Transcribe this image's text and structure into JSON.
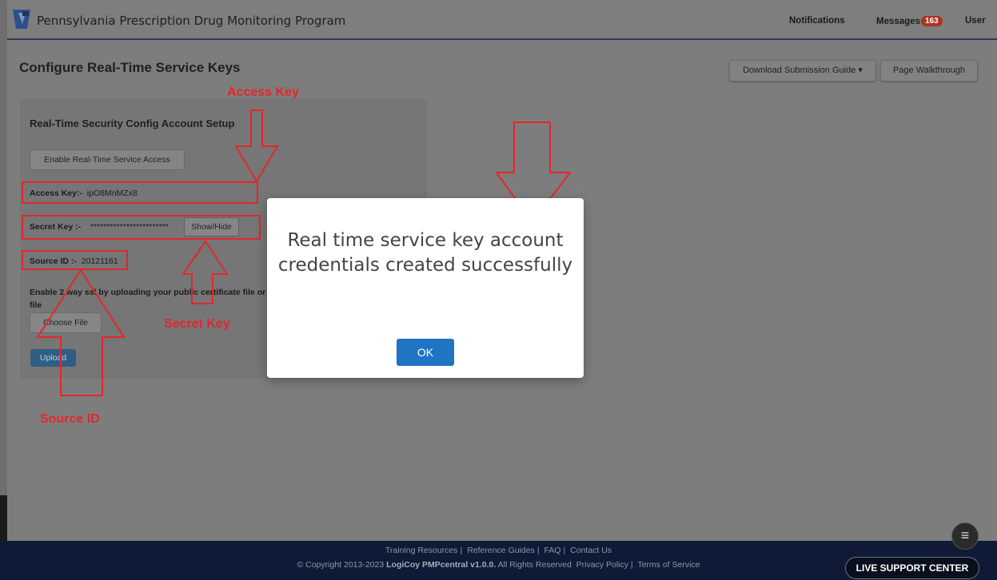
{
  "header": {
    "app_title": "Pennsylvania Prescription Drug Monitoring Program",
    "notifications_label": "Notifications",
    "messages_label": "Messages",
    "messages_count": "163",
    "user_label": "User"
  },
  "page": {
    "title": "Configure Real-Time Service Keys",
    "download_guide_label": "Download Submission Guide ▾",
    "walkthrough_label": "Page Walkthrough"
  },
  "panel": {
    "title": "Real-Time Security Config Account Setup",
    "enable_button": "Enable Real-Time Service Access",
    "access_key_label": "Access Key:-",
    "access_key_value": "ipO8MnMZx8",
    "secret_key_label": "Secret Key :-",
    "secret_key_value": "************************",
    "show_hide_button": "Show/Hide",
    "source_id_label": "Source ID :-",
    "source_id_value": "20121161",
    "ssl_text": "Enable 2 way ssl by uploading your public certificate file or .crt file",
    "choose_file_button": "Choose File",
    "upload_button": "Upload"
  },
  "annotations": {
    "access_key": "Access Key",
    "secret_key": "Secret Key",
    "source_id": "Source ID",
    "color": "#e4262b"
  },
  "modal": {
    "message": "Real time service key account credentials created successfully",
    "ok_button": "OK"
  },
  "footer": {
    "links": [
      "Training Resources",
      "Reference Guides",
      "FAQ",
      "Contact Us"
    ],
    "copyright_prefix": "© Copyright 2013-2023",
    "copyright_brand": "LogiCoy PMPcentral v1.0.0.",
    "copyright_suffix": "All Rights Reserved",
    "privacy": "Privacy Policy |",
    "terms": "Terms of Service",
    "live_support": "LIVE SUPPORT CENTER"
  }
}
